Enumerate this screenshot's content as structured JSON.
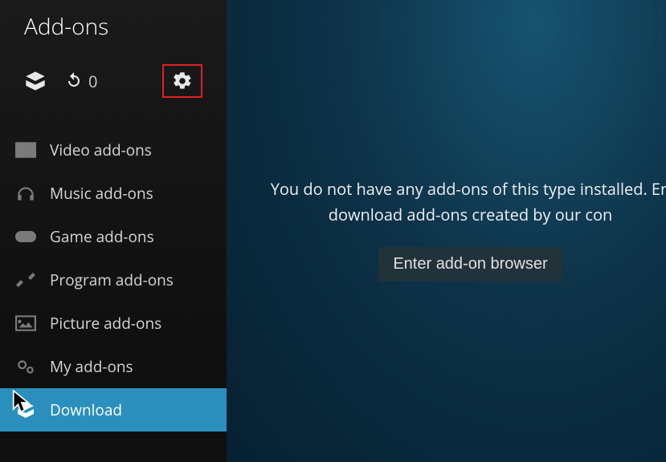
{
  "sidebar": {
    "title": "Add-ons",
    "toolbar": {
      "refresh_count": "0"
    },
    "items": [
      {
        "label": "Video add-ons"
      },
      {
        "label": "Music add-ons"
      },
      {
        "label": "Game add-ons"
      },
      {
        "label": "Program add-ons"
      },
      {
        "label": "Picture add-ons"
      },
      {
        "label": "My add-ons"
      },
      {
        "label": "Download"
      }
    ]
  },
  "content": {
    "message_line1": "You do not have any add-ons of this type installed. En",
    "message_line2": "download add-ons created by our con",
    "browser_button": "Enter add-on browser"
  }
}
